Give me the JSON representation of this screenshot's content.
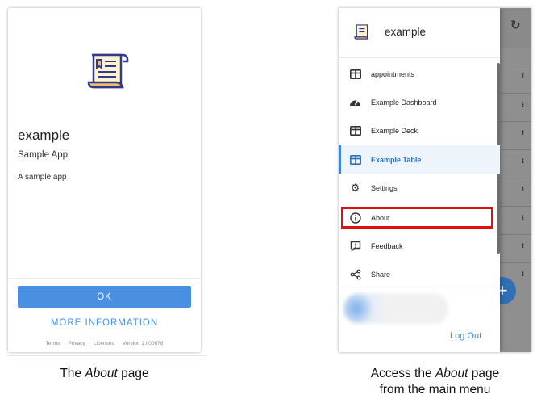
{
  "about_page": {
    "app_name": "example",
    "subtitle": "Sample App",
    "description": "A sample app",
    "ok_label": "OK",
    "more_info_label": "MORE INFORMATION",
    "footer": {
      "terms": "Terms",
      "privacy": "Privacy",
      "licenses": "Licenses",
      "version": "Version 1.000678"
    }
  },
  "drawer": {
    "app_name": "example",
    "items": [
      {
        "label": "appointments",
        "icon": "table-icon"
      },
      {
        "label": "Example Dashboard",
        "icon": "dashboard-icon"
      },
      {
        "label": "Example Deck",
        "icon": "table-icon"
      },
      {
        "label": "Example Table",
        "icon": "table-icon",
        "active": true
      },
      {
        "label": "Settings",
        "icon": "gear-icon"
      },
      {
        "label": "About",
        "icon": "info-icon",
        "highlighted": true
      },
      {
        "label": "Feedback",
        "icon": "feedback-icon"
      },
      {
        "label": "Share",
        "icon": "share-icon"
      }
    ],
    "logout_label": "Log Out"
  },
  "captions": {
    "left_prefix": "The ",
    "left_em": "About",
    "left_suffix": " page",
    "right_line1_prefix": "Access the ",
    "right_line1_em": "About",
    "right_line1_suffix": " page",
    "right_line2": "from the main menu"
  },
  "colors": {
    "accent": "#4a90e2",
    "highlight": "#e01010",
    "active_bg": "#eef4fb"
  }
}
